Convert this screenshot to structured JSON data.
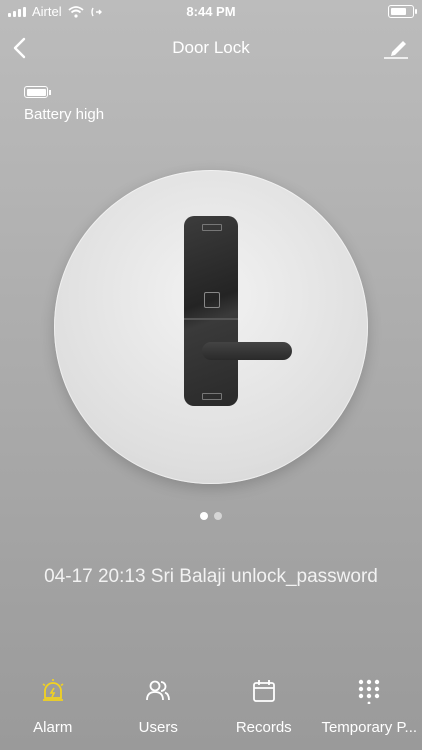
{
  "status_bar": {
    "carrier": "Airtel",
    "time": "8:44 PM"
  },
  "nav": {
    "title": "Door Lock"
  },
  "battery": {
    "label": "Battery high"
  },
  "pager": {
    "count": 2,
    "active": 0
  },
  "last_record": {
    "text": "04-17 20:13  Sri Balaji unlock_password"
  },
  "tabs": [
    {
      "label": "Alarm",
      "icon": "alarm-icon"
    },
    {
      "label": "Users",
      "icon": "users-icon"
    },
    {
      "label": "Records",
      "icon": "calendar-icon"
    },
    {
      "label": "Temporary P...",
      "icon": "keypad-icon"
    }
  ],
  "colors": {
    "alarm_accent": "#f2d21f"
  }
}
